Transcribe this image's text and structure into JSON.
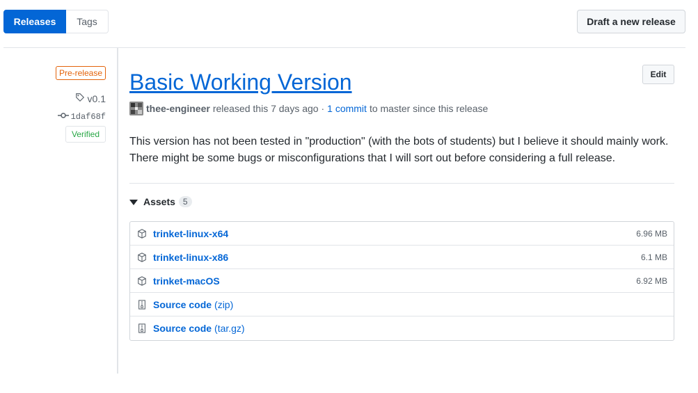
{
  "tabs": {
    "releases": "Releases",
    "tags": "Tags"
  },
  "draft_button": "Draft a new release",
  "meta": {
    "prerelease": "Pre-release",
    "tag": "v0.1",
    "commit": "1daf68f",
    "verified": "Verified"
  },
  "release": {
    "title": "Basic Working Version",
    "edit": "Edit",
    "author": "thee-engineer",
    "released_text": "released this 7 days ago ·",
    "commits_link": "1 commit",
    "since_text": "to master since this release",
    "body": "This version has not been tested in \"production\" (with the bots of students) but I believe it should mainly work. There might be some bugs or misconfigurations that I will sort out before considering a full release."
  },
  "assets": {
    "label": "Assets",
    "count": "5",
    "items": [
      {
        "name": "trinket-linux-x64",
        "ext": "",
        "size": "6.96 MB",
        "icon": "package-icon"
      },
      {
        "name": "trinket-linux-x86",
        "ext": "",
        "size": "6.1 MB",
        "icon": "package-icon"
      },
      {
        "name": "trinket-macOS",
        "ext": "",
        "size": "6.92 MB",
        "icon": "package-icon"
      },
      {
        "name": "Source code",
        "ext": "(zip)",
        "size": "",
        "icon": "zip-icon"
      },
      {
        "name": "Source code",
        "ext": "(tar.gz)",
        "size": "",
        "icon": "zip-icon"
      }
    ]
  },
  "colors": {
    "accent": "#0366d6",
    "prerelease": "#e36209",
    "verified": "#28a745"
  }
}
